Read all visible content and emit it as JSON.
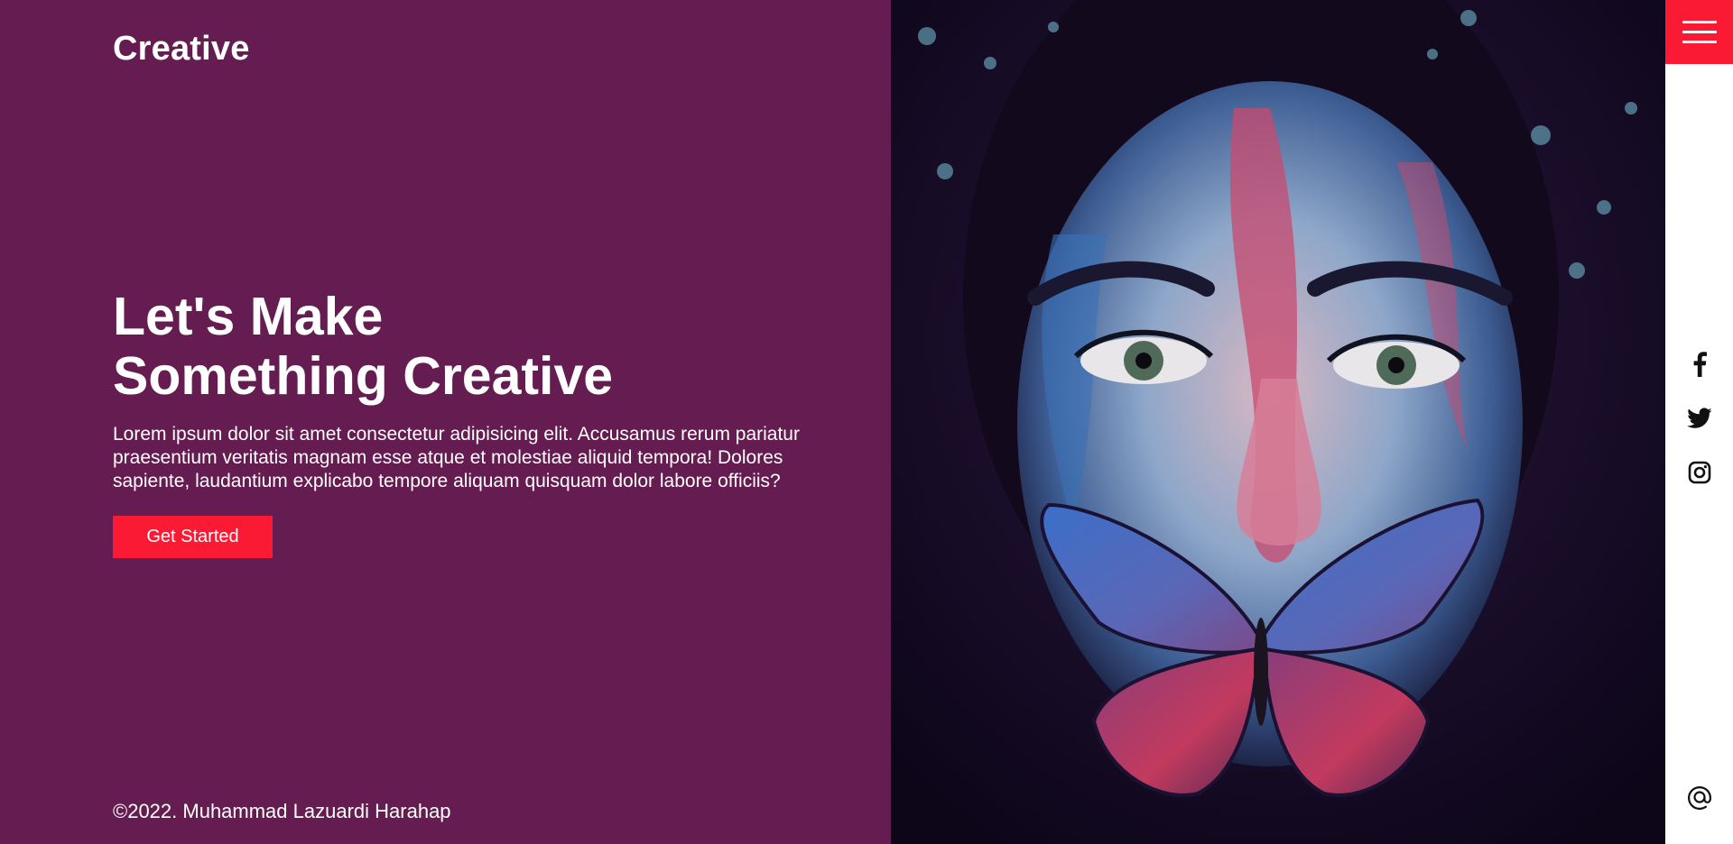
{
  "brand": {
    "logo": "Creative"
  },
  "hero": {
    "title_line1": "Let's Make",
    "title_line2": "Something Creative",
    "description": "Lorem ipsum dolor sit amet consectetur adipisicing elit. Accusamus rerum pariatur praesentium veritatis magnam esse atque et molestiae aliquid tempora! Dolores sapiente, laudantium explicabo tempore aliquam quisquam dolor labore officiis?",
    "cta_label": "Get Started"
  },
  "footer": {
    "copyright": "©2022. Muhammad Lazuardi Harahap"
  },
  "image": {
    "subject": "woman-with-painted-face-and-butterfly"
  },
  "sidebar": {
    "menu_icon": "hamburger-menu-icon",
    "social": [
      "facebook-icon",
      "twitter-icon",
      "instagram-icon"
    ],
    "contact_icon": "at-sign-icon"
  },
  "colors": {
    "background": "#651c50",
    "accent": "#fa1a33",
    "text": "#ffffff",
    "rail": "#ffffff"
  }
}
